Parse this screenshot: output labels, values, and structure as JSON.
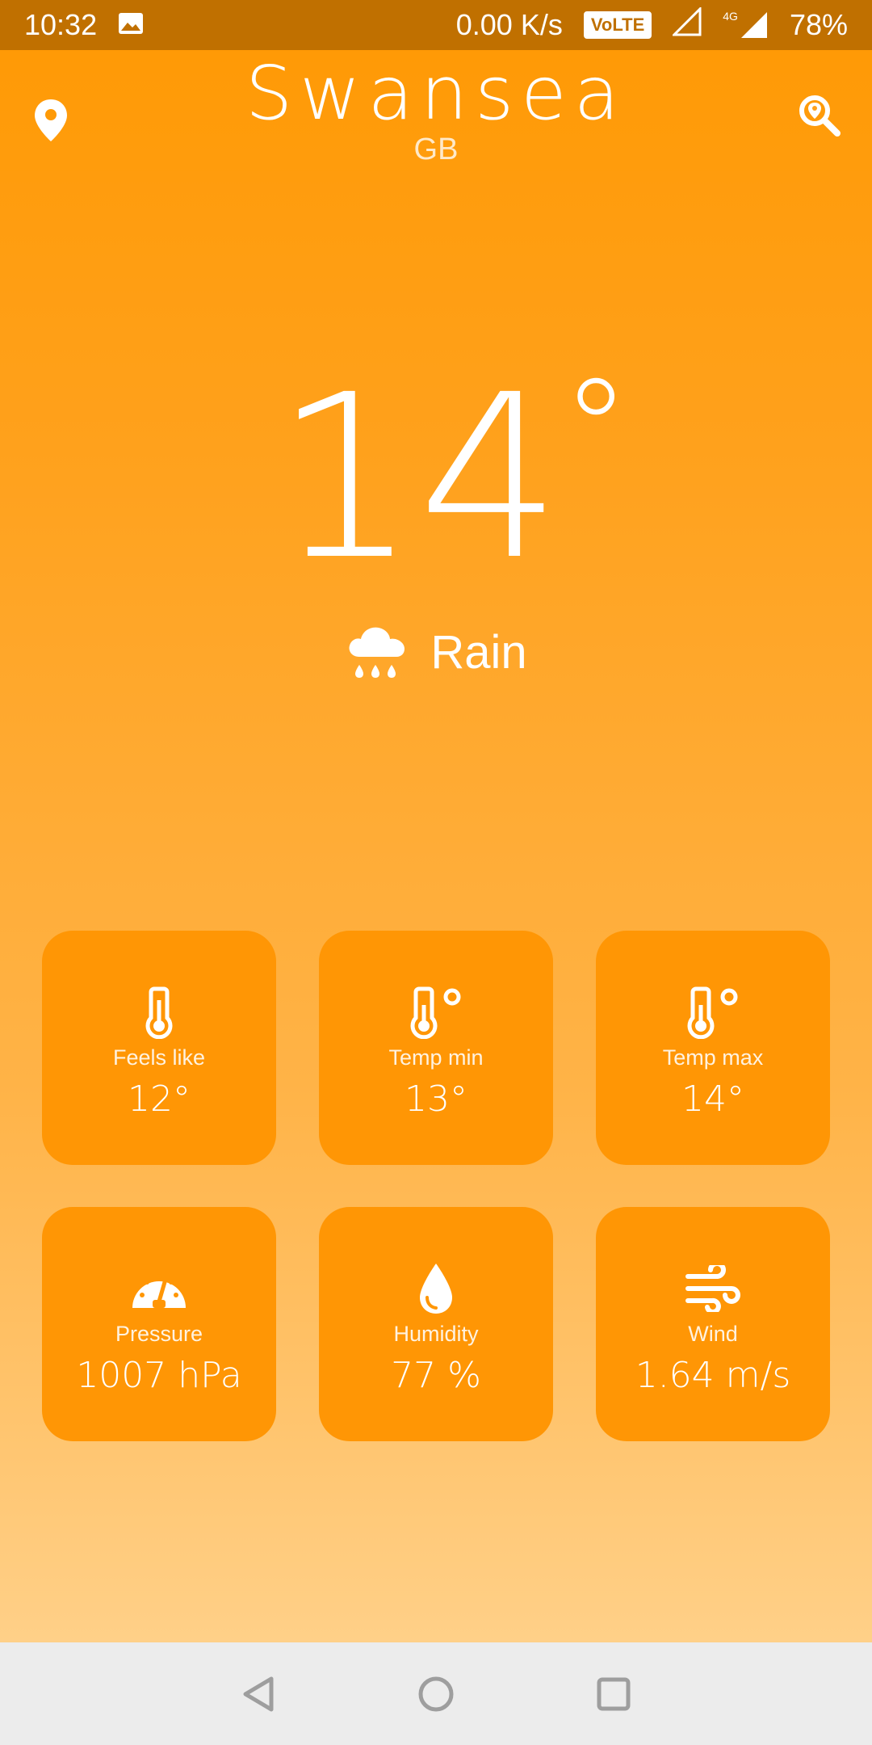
{
  "status_bar": {
    "time": "10:32",
    "network_speed": "0.00 K/s",
    "volte": "VoLTE",
    "network_type": "4G",
    "battery": "78%"
  },
  "header": {
    "city": "Swansea",
    "country": "GB",
    "location_icon": "location-pin-icon",
    "search_icon": "search-location-icon"
  },
  "current": {
    "temperature": "14",
    "degree_symbol": "°",
    "condition": "Rain",
    "condition_icon": "rain-cloud-icon"
  },
  "cards": [
    {
      "label": "Feels like",
      "value": "12°",
      "icon": "thermometer-icon"
    },
    {
      "label": "Temp min",
      "value": "13°",
      "icon": "thermometer-degree-icon"
    },
    {
      "label": "Temp max",
      "value": "14°",
      "icon": "thermometer-degree-icon"
    },
    {
      "label": "Pressure",
      "value": "1007 hPa",
      "icon": "gauge-icon"
    },
    {
      "label": "Humidity",
      "value": "77 %",
      "icon": "water-drop-icon"
    },
    {
      "label": "Wind",
      "value": "1.64 m/s",
      "icon": "wind-icon"
    }
  ],
  "colors": {
    "status_bar": "#c07000",
    "gradient_top": "#ff9a06",
    "gradient_bottom": "#ffd088",
    "card": "#ff9605",
    "nav_bar": "#ececec"
  }
}
